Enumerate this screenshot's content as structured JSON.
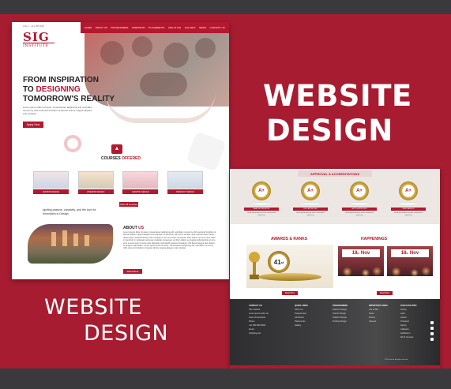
{
  "promo": {
    "big_line1": "WEBSITE",
    "big_line2": "DESIGN",
    "small_line1": "WEBSITE",
    "small_line2": "DESIGN"
  },
  "colors": {
    "brand_red": "#b3182e",
    "background_red": "#a71c30",
    "frame_dark": "#3a3a3c"
  },
  "page1": {
    "contact": "CALL : +91 999 999",
    "logo_main": "SIG",
    "logo_sub": "INSTITUTE",
    "nav": [
      "HOME",
      "ABOUT US",
      "PROGRAMMES",
      "ADMISSION",
      "PLACEMENTS",
      "LIFE AT SIG",
      "GALLERY",
      "NEWS",
      "CONTACT US"
    ],
    "hero_line1": "FROM INSPIRATION",
    "hero_line2_prefix": "TO ",
    "hero_line2_red": "DESIGNING",
    "hero_line3": "TOMORROW'S REALITY",
    "hero_text": "Lorem ipsum dolor sit amet, consectetuer adipiscing elit, sed diam nonummy nibh euismod tincidunt ut laoreet dolore magna aliquam erat volutpat.",
    "apply_button": "Apply Now",
    "courses_title_prefix": "COURSES ",
    "courses_title_red": "OFFERED",
    "courses": [
      "FASHION DESIGN",
      "INTERIOR DESIGN",
      "GRAPHIC DESIGN",
      "PRODUCT DESIGN"
    ],
    "view_all": "View All Courses",
    "tagline": "Igniting passion, creativity, and the love for Innovation in Design",
    "about_title_prefix": "ABOUT ",
    "about_title_red": "US",
    "about_text": "Lorem ipsum dolor sit amet, consectetuer adipiscing elit, sed diam nonummy nibh euismod tincidunt ut laoreet dolore magna aliquam erat volutpat. Ut wisi enim ad minim veniam, quis nostrud exerci tation ullamcorper suscipit lobortis nisl ut aliquip ex ea commodo consequat. Duis autem vel eum iriure dolor in hendrerit in vulputate velit esse molestie consequat, vel illum dolore eu feugiat nulla facilisis at vero eros et accumsan et iusto odio dignissim qui blandit praesent luptatum zzril delenit augue duis dolore te feugait nulla facilisi. Lorem ipsum dolor sit amet, consectetuer adipiscing elit, sed diam nonummy nibh euismod tincidunt ut laoreet dolore magna aliquam erat volutpat.",
    "read_more": "Read More"
  },
  "page2": {
    "accred_title": "APPROVAL & ACCREDITATIONS",
    "badges": [
      {
        "grade": "A+",
        "label": "NAAC ACCREDITED",
        "text": "Lorem ipsum dolor sit amet consectetuer adipiscing"
      },
      {
        "grade": "A+",
        "label": "UGC APPROVED",
        "text": "Lorem ipsum dolor sit amet consectetuer adipiscing"
      },
      {
        "grade": "A+",
        "label": "AICTE APPROVED",
        "text": "Lorem ipsum dolor sit amet consectetuer adipiscing"
      },
      {
        "grade": "A+",
        "label": "NIRF RANKED",
        "text": "Lorem ipsum dolor sit amet consectetuer adipiscing"
      }
    ],
    "awards_title": "AWARDS & RANKS",
    "award_number": "41",
    "award_sup": "st",
    "award_read": "Read More",
    "happen_title": "HAPPENINGS",
    "events": [
      {
        "day": "18",
        "sup": "th",
        "month": "Nov"
      },
      {
        "day": "18",
        "sup": "th",
        "month": "Nov"
      }
    ],
    "event_read": "Read More",
    "footer_cols": [
      {
        "head": "CONTACT US",
        "lines": [
          "SIG Institute",
          "Lorem ipsum dolor sit",
          "amet consectetuer",
          "",
          "Phone",
          "+91 999 999 9999",
          "",
          "Email",
          "info@sig.edu"
        ]
      },
      {
        "head": "QUICK LINKS",
        "lines": [
          "About Us",
          "Programmes",
          "Admission",
          "Placements",
          "Gallery"
        ]
      },
      {
        "head": "PROGRAMMES",
        "lines": [
          "Fashion Design",
          "Interior Design",
          "Graphic Design",
          "Product Design"
        ]
      },
      {
        "head": "IMPORTANT LINKS",
        "lines": [
          "Life at SIG",
          "News",
          "Events",
          "Careers"
        ]
      },
      {
        "head": "OUR FACILITIES",
        "lines": [
          "Library",
          "Labs",
          "Hostel",
          "Transport",
          "Sports",
          "Cafeteria",
          "Auditorium",
          "Wi-Fi Campus"
        ]
      }
    ],
    "copyright": "© SIG Institute. All rights reserved"
  }
}
